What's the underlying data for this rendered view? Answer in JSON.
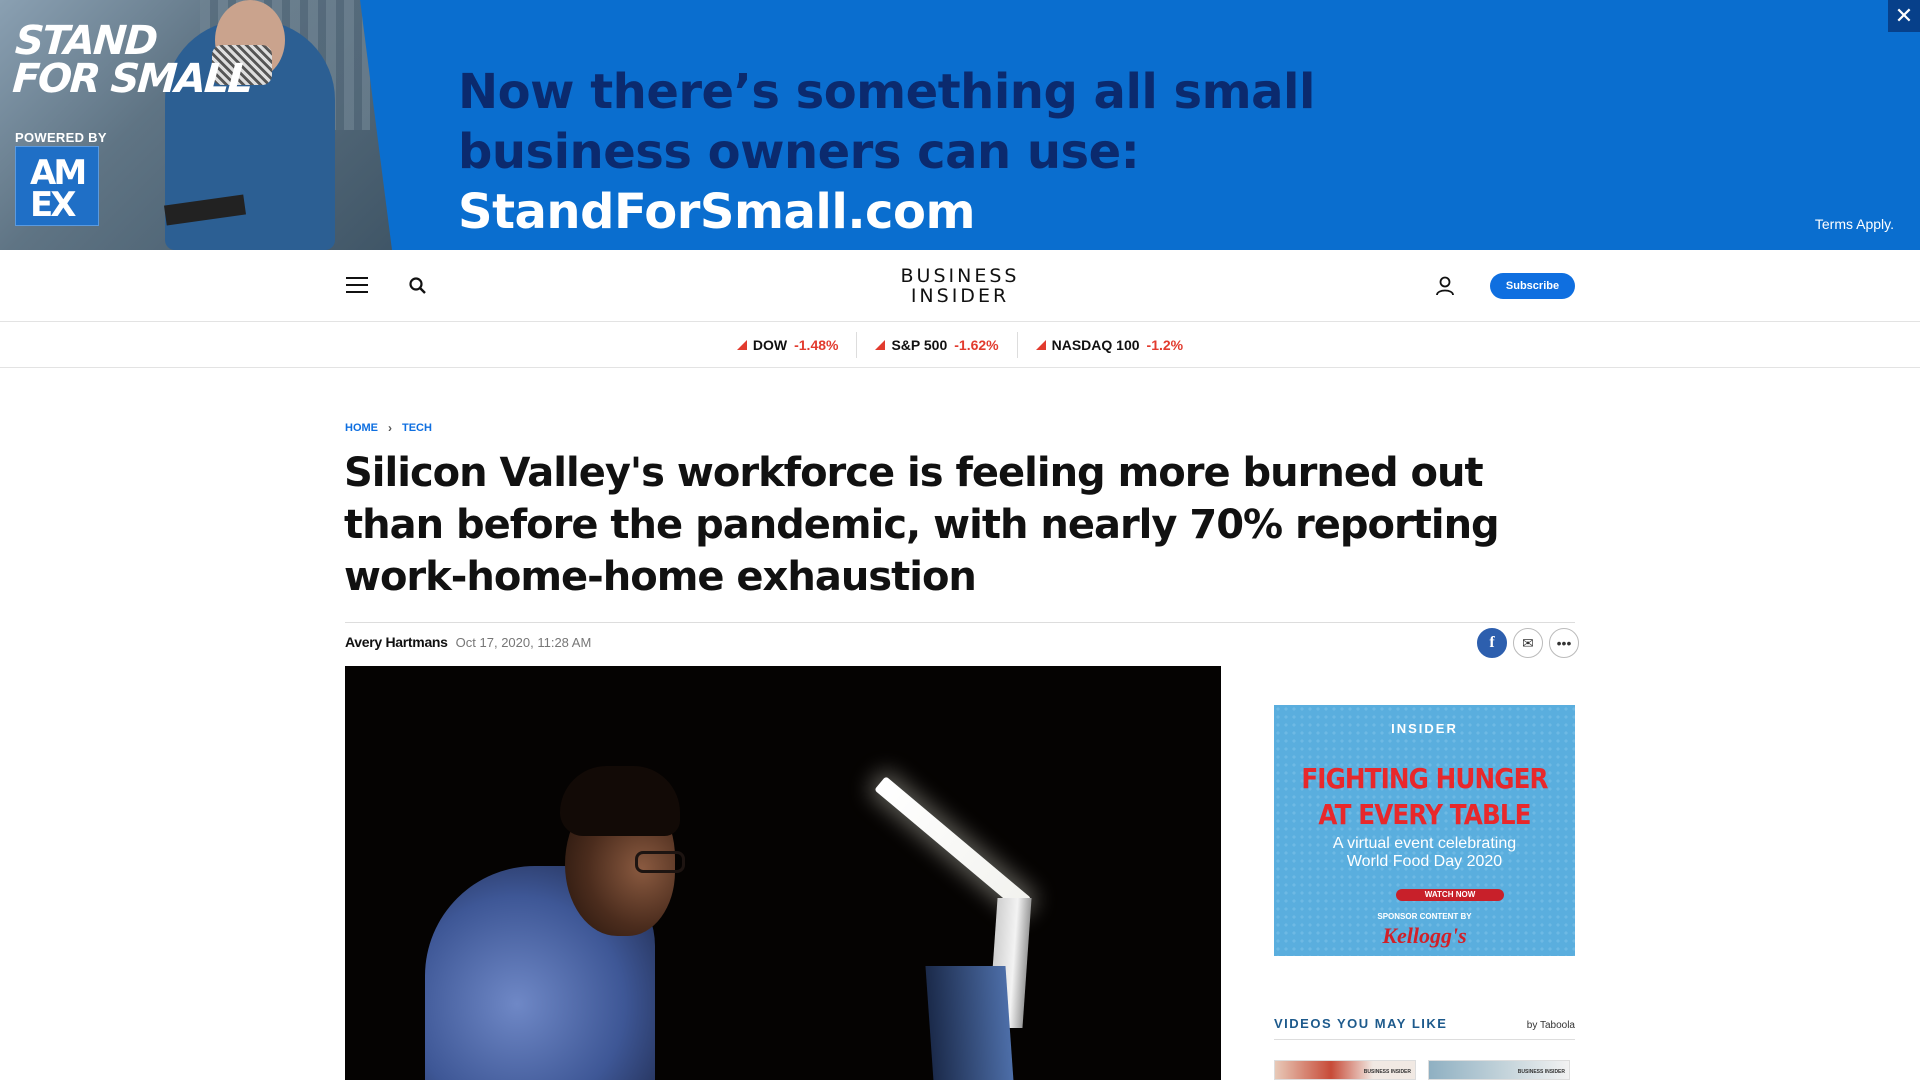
{
  "ad_banner": {
    "logo_line1": "STAND",
    "logo_line2": "FOR SMALL",
    "powered_by": "POWERED BY",
    "amex_line1": "AM",
    "amex_line2": "EX",
    "headline_main": "Now there’s something all small business owners can use: ",
    "headline_url": "StandForSmall.com",
    "terms": "Terms Apply.",
    "close": "✕"
  },
  "header": {
    "brand_line1": "BUSINESS",
    "brand_line2": "INSIDER",
    "subscribe_label": "Subscribe"
  },
  "ticker": [
    {
      "name": "DOW",
      "value": "-1.48%"
    },
    {
      "name": "S&P 500",
      "value": "-1.62%"
    },
    {
      "name": "NASDAQ 100",
      "value": "-1.2%"
    }
  ],
  "breadcrumb": {
    "home": "HOME",
    "section": "TECH"
  },
  "article": {
    "headline": "Silicon Valley's workforce is feeling more burned out than before the pandemic, with nearly 70% reporting work-home-home exhaustion",
    "author": "Avery Hartmans",
    "date": "Oct 17, 2020, 11:28 AM"
  },
  "share": {
    "facebook": "f",
    "email": "✉",
    "more": "•••"
  },
  "sidebar_ad": {
    "brand": "INSIDER",
    "title_line1": "FIGHTING HUNGER",
    "title_line2": "AT EVERY TABLE",
    "sub_line1": "A virtual event celebrating",
    "sub_line2": "World Food Day 2020",
    "button": "WATCH NOW",
    "sponsor": "SPONSOR CONTENT BY",
    "sponsor_brand": "Kellogg's"
  },
  "videos": {
    "title": "VIDEOS YOU MAY LIKE",
    "provider": "by Taboola",
    "thumbs": [
      {
        "label": "BUSINESS INSIDER"
      },
      {
        "label": "BUSINESS INSIDER"
      }
    ]
  },
  "colors": {
    "ad_blue": "#0a6ecf",
    "headline_navy": "#0b2a6e",
    "link_blue": "#0f6fe0",
    "ticker_red": "#e23b2e",
    "sidebar_ad_red": "#e8282b"
  },
  "icons": [
    "close-icon",
    "menu-icon",
    "search-icon",
    "user-icon",
    "down-arrow-icon",
    "chevron-right-icon",
    "facebook-icon",
    "email-icon",
    "more-icon"
  ]
}
